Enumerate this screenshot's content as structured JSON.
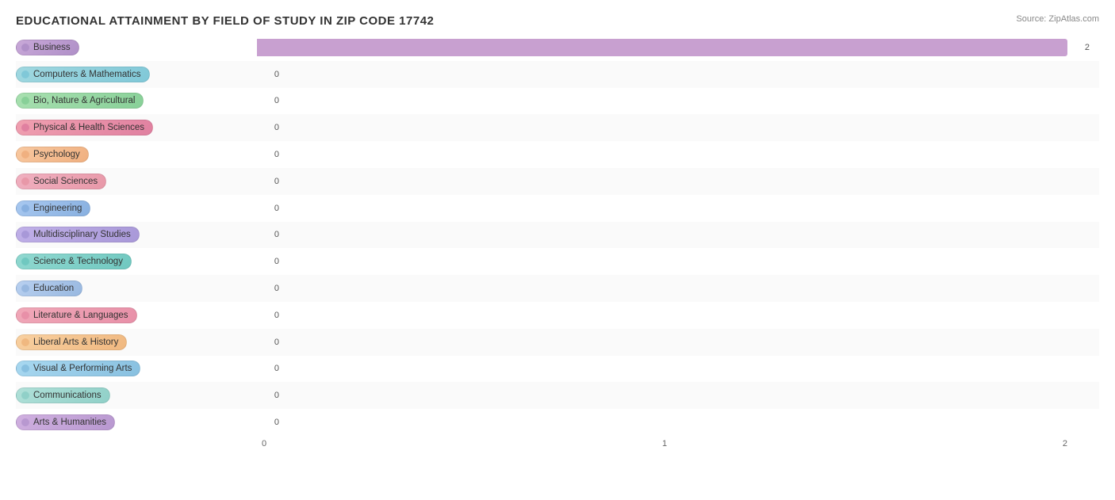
{
  "title": "EDUCATIONAL ATTAINMENT BY FIELD OF STUDY IN ZIP CODE 17742",
  "source": "Source: ZipAtlas.com",
  "xLabels": [
    "0",
    "1",
    "2"
  ],
  "maxValue": 2,
  "bars": [
    {
      "label": "Business",
      "value": 2,
      "valueStr": "2",
      "color1": "#c8a8d8",
      "color2": "#b090c8",
      "dotColor": "#b090c8",
      "barColor": "#c8a0d0",
      "fillPercent": 100
    },
    {
      "label": "Computers & Mathematics",
      "value": 0,
      "valueStr": "0",
      "color1": "#a0d8e0",
      "color2": "#80c8d8",
      "dotColor": "#80c8d8",
      "barColor": "#90d0d8",
      "fillPercent": 0
    },
    {
      "label": "Bio, Nature & Agricultural",
      "value": 0,
      "valueStr": "0",
      "color1": "#a8e0b0",
      "color2": "#88d098",
      "dotColor": "#88d098",
      "barColor": "#98d8a0",
      "fillPercent": 0
    },
    {
      "label": "Physical & Health Sciences",
      "value": 0,
      "valueStr": "0",
      "color1": "#f0a0b0",
      "color2": "#e080a0",
      "dotColor": "#e080a0",
      "barColor": "#e898a8",
      "fillPercent": 0
    },
    {
      "label": "Psychology",
      "value": 0,
      "valueStr": "0",
      "color1": "#f8c8a0",
      "color2": "#f0b080",
      "dotColor": "#f0b080",
      "barColor": "#f4bc90",
      "fillPercent": 0
    },
    {
      "label": "Social Sciences",
      "value": 0,
      "valueStr": "0",
      "color1": "#f0b0c0",
      "color2": "#e898a8",
      "dotColor": "#e898a8",
      "barColor": "#f0a8b8",
      "fillPercent": 0
    },
    {
      "label": "Engineering",
      "value": 0,
      "valueStr": "0",
      "color1": "#a8c8f0",
      "color2": "#88b0e0",
      "dotColor": "#88b0e0",
      "barColor": "#98bce8",
      "fillPercent": 0
    },
    {
      "label": "Multidisciplinary Studies",
      "value": 0,
      "valueStr": "0",
      "color1": "#c0b0e8",
      "color2": "#a898d8",
      "dotColor": "#a898d8",
      "barColor": "#b4a4e0",
      "fillPercent": 0
    },
    {
      "label": "Science & Technology",
      "value": 0,
      "valueStr": "0",
      "color1": "#90d8d0",
      "color2": "#70c8c0",
      "dotColor": "#70c8c0",
      "barColor": "#80d0c8",
      "fillPercent": 0
    },
    {
      "label": "Education",
      "value": 0,
      "valueStr": "0",
      "color1": "#b8d0f0",
      "color2": "#98b8e0",
      "dotColor": "#98b8e0",
      "barColor": "#a8c4e8",
      "fillPercent": 0
    },
    {
      "label": "Literature & Languages",
      "value": 0,
      "valueStr": "0",
      "color1": "#f0a8b8",
      "color2": "#e890a8",
      "dotColor": "#e890a8",
      "barColor": "#eca0b0",
      "fillPercent": 0
    },
    {
      "label": "Liberal Arts & History",
      "value": 0,
      "valueStr": "0",
      "color1": "#f8d0a0",
      "color2": "#f0b880",
      "dotColor": "#f0b880",
      "barColor": "#f4c490",
      "fillPercent": 0
    },
    {
      "label": "Visual & Performing Arts",
      "value": 0,
      "valueStr": "0",
      "color1": "#a8d8f0",
      "color2": "#88c0e0",
      "dotColor": "#88c0e0",
      "barColor": "#98cce8",
      "fillPercent": 0
    },
    {
      "label": "Communications",
      "value": 0,
      "valueStr": "0",
      "color1": "#b0e0d8",
      "color2": "#90d0c8",
      "dotColor": "#90d0c8",
      "barColor": "#a0d8d0",
      "fillPercent": 0
    },
    {
      "label": "Arts & Humanities",
      "value": 0,
      "valueStr": "0",
      "color1": "#d0b0e0",
      "color2": "#b898d0",
      "dotColor": "#b898d0",
      "barColor": "#c4a4d8",
      "fillPercent": 0
    }
  ]
}
